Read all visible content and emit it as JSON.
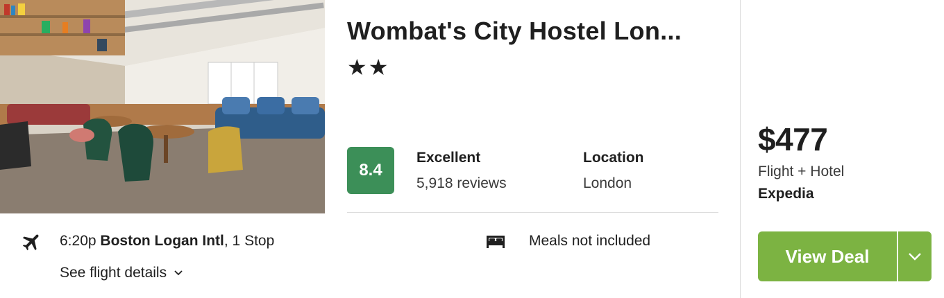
{
  "hotel": {
    "name": "Wombat's City Hostel Lon...",
    "stars": "★★",
    "score": "8.4",
    "rating_label": "Excellent",
    "reviews": "5,918 reviews",
    "location_label": "Location",
    "location_value": "London"
  },
  "flight": {
    "time": "6:20p",
    "airport": "Boston Logan Intl",
    "stops": ", 1 Stop",
    "details_link": "See flight details",
    "icon": "airplane-icon"
  },
  "amenity": {
    "meals": "Meals not included",
    "icon": "bed-icon"
  },
  "deal": {
    "price": "$477",
    "package": "Flight + Hotel",
    "provider": "Expedia",
    "button_label": "View Deal"
  },
  "colors": {
    "score_bg": "#3c8f58",
    "deal_button": "#7cb342",
    "divider": "#dcdcdc"
  }
}
